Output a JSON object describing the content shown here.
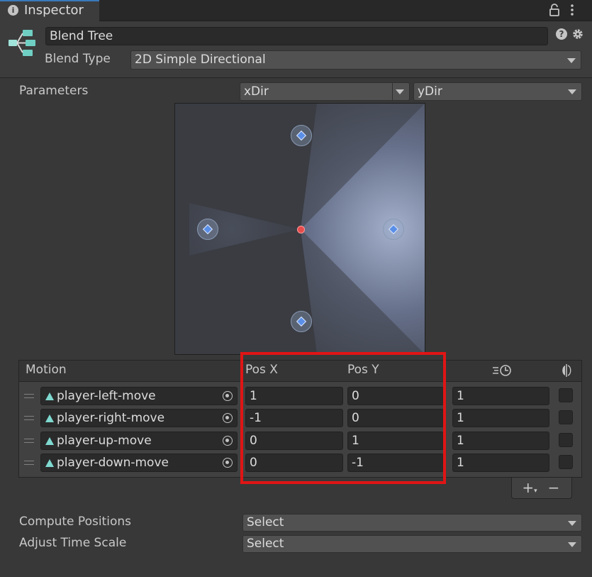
{
  "tab": {
    "title": "Inspector"
  },
  "header": {
    "name": "Blend Tree",
    "blend_type_label": "Blend Type",
    "blend_type_value": "2D Simple Directional"
  },
  "parameters": {
    "label": "Parameters",
    "x_param": "xDir",
    "y_param": "yDir"
  },
  "motion_list": {
    "headers": {
      "motion": "Motion",
      "pos_x": "Pos X",
      "pos_y": "Pos Y"
    },
    "rows": [
      {
        "motion": "player-left-move",
        "pos_x": "1",
        "pos_y": "0",
        "speed": "1"
      },
      {
        "motion": "player-right-move",
        "pos_x": "-1",
        "pos_y": "0",
        "speed": "1"
      },
      {
        "motion": "player-up-move",
        "pos_x": "0",
        "pos_y": "1",
        "speed": "1"
      },
      {
        "motion": "player-down-move",
        "pos_x": "0",
        "pos_y": "-1",
        "speed": "1"
      }
    ],
    "add_label": "+",
    "remove_label": "−"
  },
  "compute_positions": {
    "label": "Compute Positions",
    "value": "Select"
  },
  "adjust_time_scale": {
    "label": "Adjust Time Scale",
    "value": "Select"
  },
  "colors": {
    "accent": "#3a79bb",
    "highlight_box": "#e01515",
    "center_marker": "#e74c4c",
    "clip_icon": "#7fd9d0"
  }
}
